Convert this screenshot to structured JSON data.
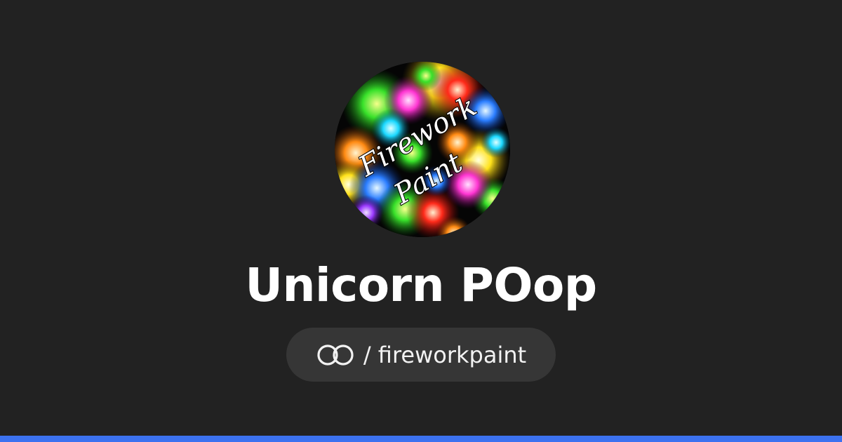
{
  "profile": {
    "name": "Unicorn POop",
    "handle_separator": "/",
    "handle": "fireworkpaint",
    "handle_display": "/ fireworkpaint",
    "logo_icon": "linked-rings-icon",
    "avatar_text_line1": "Firework",
    "avatar_text_line2": "Paint"
  },
  "colors": {
    "background": "#222222",
    "pill": "#363636",
    "accent_bar": "#3c72f0",
    "text": "#ffffff"
  }
}
